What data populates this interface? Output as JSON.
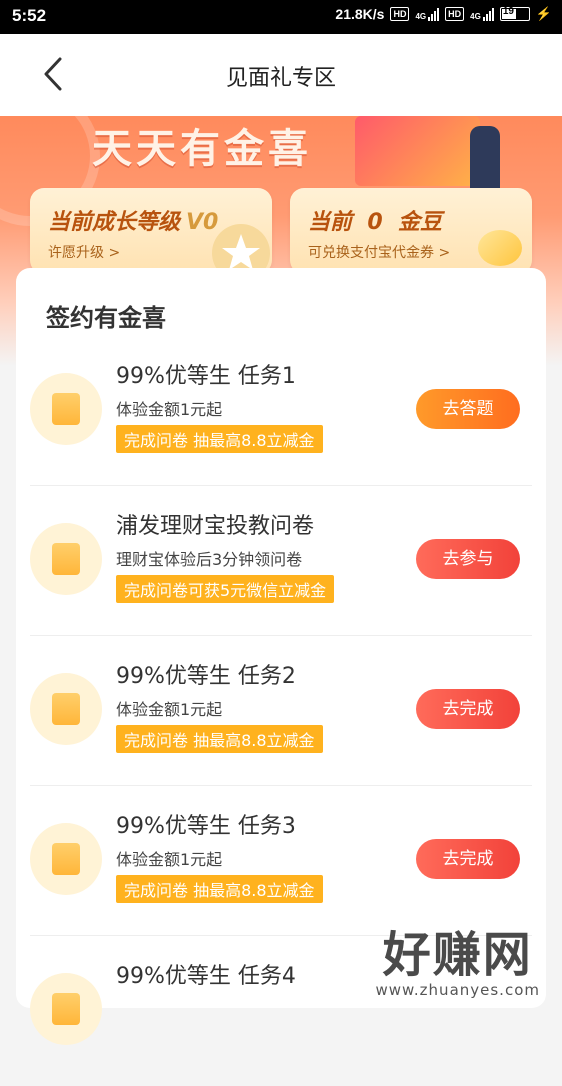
{
  "status_bar": {
    "time": "5:52",
    "speed": "21.8K/s",
    "hd1": "HD",
    "net1": "4G",
    "hd2": "HD",
    "net2": "4G",
    "battery": "19"
  },
  "header": {
    "title": "见面礼专区"
  },
  "hero": {
    "slogan": "天天有金喜"
  },
  "growth_card": {
    "title": "当前成长等级",
    "level": "V0",
    "link": "许愿升级 >"
  },
  "bean_card": {
    "title": "当前  0  金豆",
    "link": "可兑换支付宝代金券 >"
  },
  "section": {
    "title": "签约有金喜"
  },
  "tasks": [
    {
      "title": "99%优等生 任务1",
      "subtitle": "体验金额1元起",
      "tag": "完成问卷 抽最高8.8立减金",
      "button": "去答题",
      "button_color": "#ff7b22"
    },
    {
      "title": "浦发理财宝投教问卷",
      "subtitle": "理财宝体验后3分钟领问卷",
      "tag": "完成问卷可获5元微信立减金",
      "button": "去参与",
      "button_color": "#f5483c"
    },
    {
      "title": "99%优等生 任务2",
      "subtitle": "体验金额1元起",
      "tag": "完成问卷 抽最高8.8立减金",
      "button": "去完成",
      "button_color": "#f5483c"
    },
    {
      "title": "99%优等生 任务3",
      "subtitle": "体验金额1元起",
      "tag": "完成问卷 抽最高8.8立减金",
      "button": "去完成",
      "button_color": "#f5483c"
    },
    {
      "title": "99%优等生 任务4",
      "subtitle": "",
      "tag": "",
      "button": "",
      "button_color": "#f5483c"
    }
  ],
  "watermark": {
    "text": "好赚网",
    "url": "www.zhuanyes.com"
  }
}
